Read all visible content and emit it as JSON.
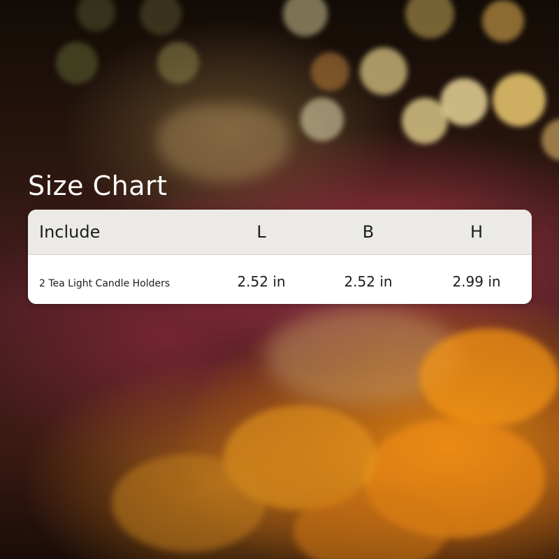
{
  "title": "Size Chart",
  "table": {
    "headers": [
      "Include",
      "L",
      "B",
      "H"
    ],
    "rows": [
      [
        "2 Tea Light Candle Holders",
        "2.52 in",
        "2.52 in",
        "2.99 in"
      ]
    ]
  }
}
